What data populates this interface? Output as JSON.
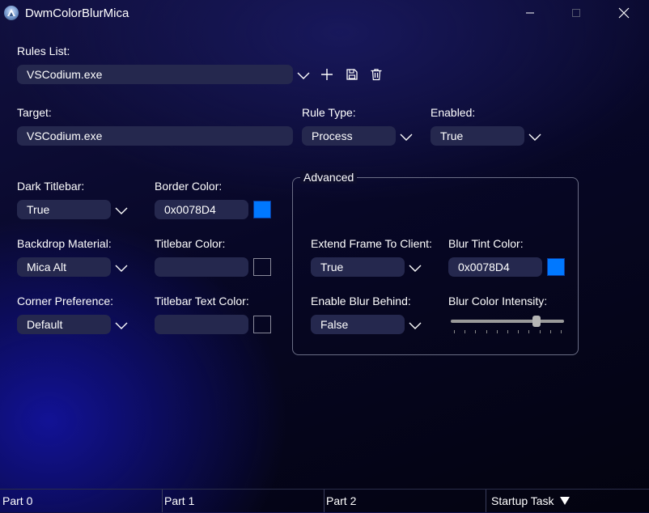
{
  "window": {
    "title": "DwmColorBlurMica",
    "icon": "app-logo-icon"
  },
  "rules": {
    "label": "Rules List:",
    "selected": "VSCodium.exe",
    "actions": [
      "add-icon",
      "save-icon",
      "delete-icon"
    ]
  },
  "target": {
    "label": "Target:",
    "value": "VSCodium.exe"
  },
  "rule_type": {
    "label": "Rule Type:",
    "value": "Process"
  },
  "enabled": {
    "label": "Enabled:",
    "value": "True"
  },
  "dark_titlebar": {
    "label": "Dark Titlebar:",
    "value": "True"
  },
  "border_color": {
    "label": "Border Color:",
    "value": "0x0078D4",
    "swatch": "#0078ff"
  },
  "backdrop": {
    "label": "Backdrop Material:",
    "value": "Mica Alt"
  },
  "titlebar_color": {
    "label": "Titlebar Color:",
    "value": ""
  },
  "corner": {
    "label": "Corner Preference:",
    "value": "Default"
  },
  "titlebar_text_color": {
    "label": "Titlebar Text Color:",
    "value": ""
  },
  "advanced": {
    "title": "Advanced",
    "extend_frame": {
      "label": "Extend Frame To Client:",
      "value": "True"
    },
    "blur_tint": {
      "label": "Blur Tint Color:",
      "value": "0x0078D4",
      "swatch": "#0078ff"
    },
    "blur_behind": {
      "label": "Enable Blur Behind:",
      "value": "False"
    },
    "blur_intensity": {
      "label": "Blur Color Intensity:",
      "level": 0.78
    }
  },
  "statusbar": {
    "part0": "Part 0",
    "part1": "Part 1",
    "part2": "Part 2",
    "startup": "Startup Task",
    "startup_icon": "triangle-down-icon"
  }
}
